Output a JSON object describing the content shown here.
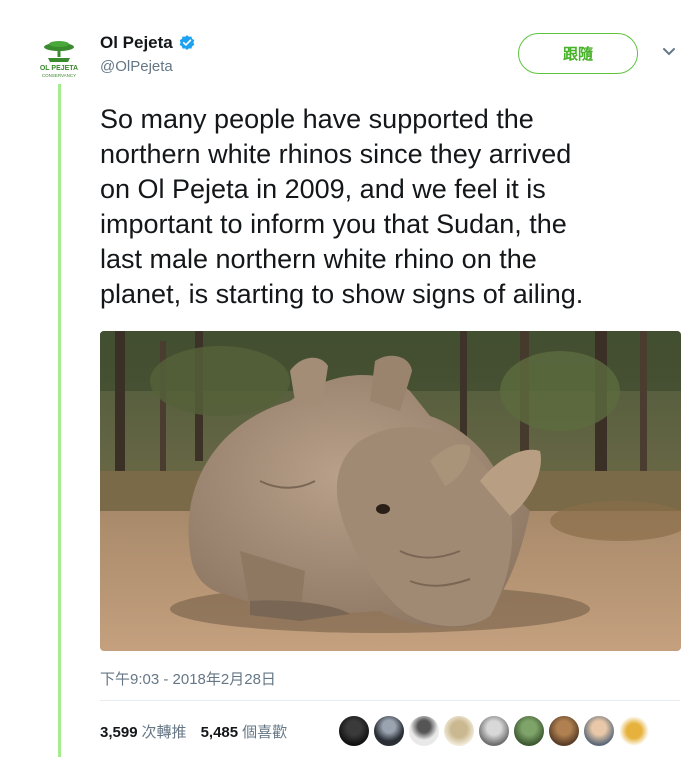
{
  "account": {
    "display_name": "Ol Pejeta",
    "handle": "@OlPejeta",
    "verified": true,
    "logo_text": "OL PEJETA",
    "logo_subtext": "CONSERVANCY"
  },
  "follow_button_label": "跟隨",
  "tweet": {
    "text_lines": [
      "So many people have supported the",
      "northern white rhinos since they arrived",
      "on Ol Pejeta in 2009, and we feel it is",
      "important to inform you that Sudan, the",
      "last male northern white rhino on the",
      "planet, is starting to show signs of ailing."
    ],
    "timestamp": "下午9:03 - 2018年2月28日"
  },
  "stats": {
    "retweets_count": "3,599",
    "retweets_label": "次轉推",
    "likes_count": "5,485",
    "likes_label": "個喜歡"
  },
  "liker_avatars": [
    "avatar-1",
    "avatar-2",
    "avatar-3",
    "avatar-4",
    "avatar-5",
    "avatar-6",
    "avatar-7",
    "avatar-8",
    "avatar-9"
  ],
  "colors": {
    "accent_green": "#5cc43d",
    "thread_line": "#a5ec8f",
    "verified_blue": "#1da1f2",
    "muted_text": "#657786"
  }
}
